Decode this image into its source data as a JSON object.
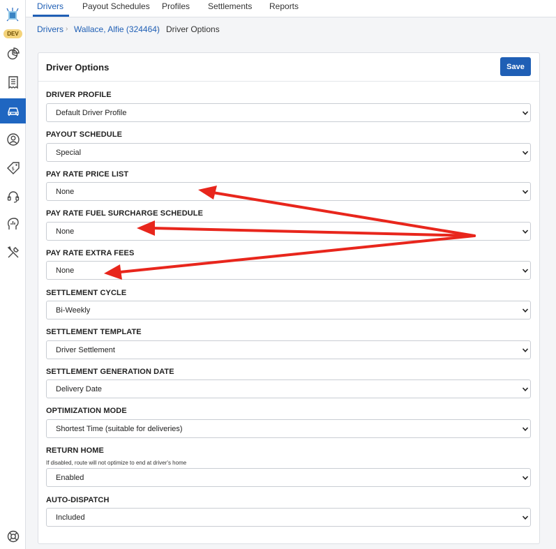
{
  "sidebar": {
    "env_badge": "DEV",
    "icons": [
      "logo-icon",
      "analytics-icon",
      "receipt-icon",
      "car-icon",
      "user-icon",
      "price-tag-icon",
      "headset-icon",
      "profile-chart-icon",
      "tools-icon",
      "lifebuoy-icon"
    ]
  },
  "tabs": [
    "Drivers",
    "Payout Schedules",
    "Profiles",
    "Settlements",
    "Reports"
  ],
  "breadcrumb": {
    "root": "Drivers",
    "driver": "Wallace, Alfie (324464)",
    "current": "Driver Options"
  },
  "card": {
    "title": "Driver Options",
    "save_label": "Save"
  },
  "fields": [
    {
      "label": "DRIVER PROFILE",
      "value": "Default Driver Profile"
    },
    {
      "label": "PAYOUT SCHEDULE",
      "value": "Special"
    },
    {
      "label": "PAY RATE PRICE LIST",
      "value": "None"
    },
    {
      "label": "PAY RATE FUEL SURCHARGE SCHEDULE",
      "value": "None"
    },
    {
      "label": "PAY RATE EXTRA FEES",
      "value": "None"
    },
    {
      "label": "SETTLEMENT CYCLE",
      "value": "Bi-Weekly"
    },
    {
      "label": "SETTLEMENT TEMPLATE",
      "value": "Driver Settlement"
    },
    {
      "label": "SETTLEMENT GENERATION DATE",
      "value": "Delivery Date"
    },
    {
      "label": "OPTIMIZATION MODE",
      "value": "Shortest Time (suitable for deliveries)"
    },
    {
      "label": "RETURN HOME",
      "help": "If disabled, route will not optimize to end at driver's home",
      "value": "Enabled"
    },
    {
      "label": "AUTO-DISPATCH",
      "value": "Included"
    }
  ],
  "colors": {
    "accent": "#1f5fb5",
    "active_nav": "#1f66c1",
    "badge": "#f4d37a",
    "annotation_arrow": "#e8261c"
  }
}
